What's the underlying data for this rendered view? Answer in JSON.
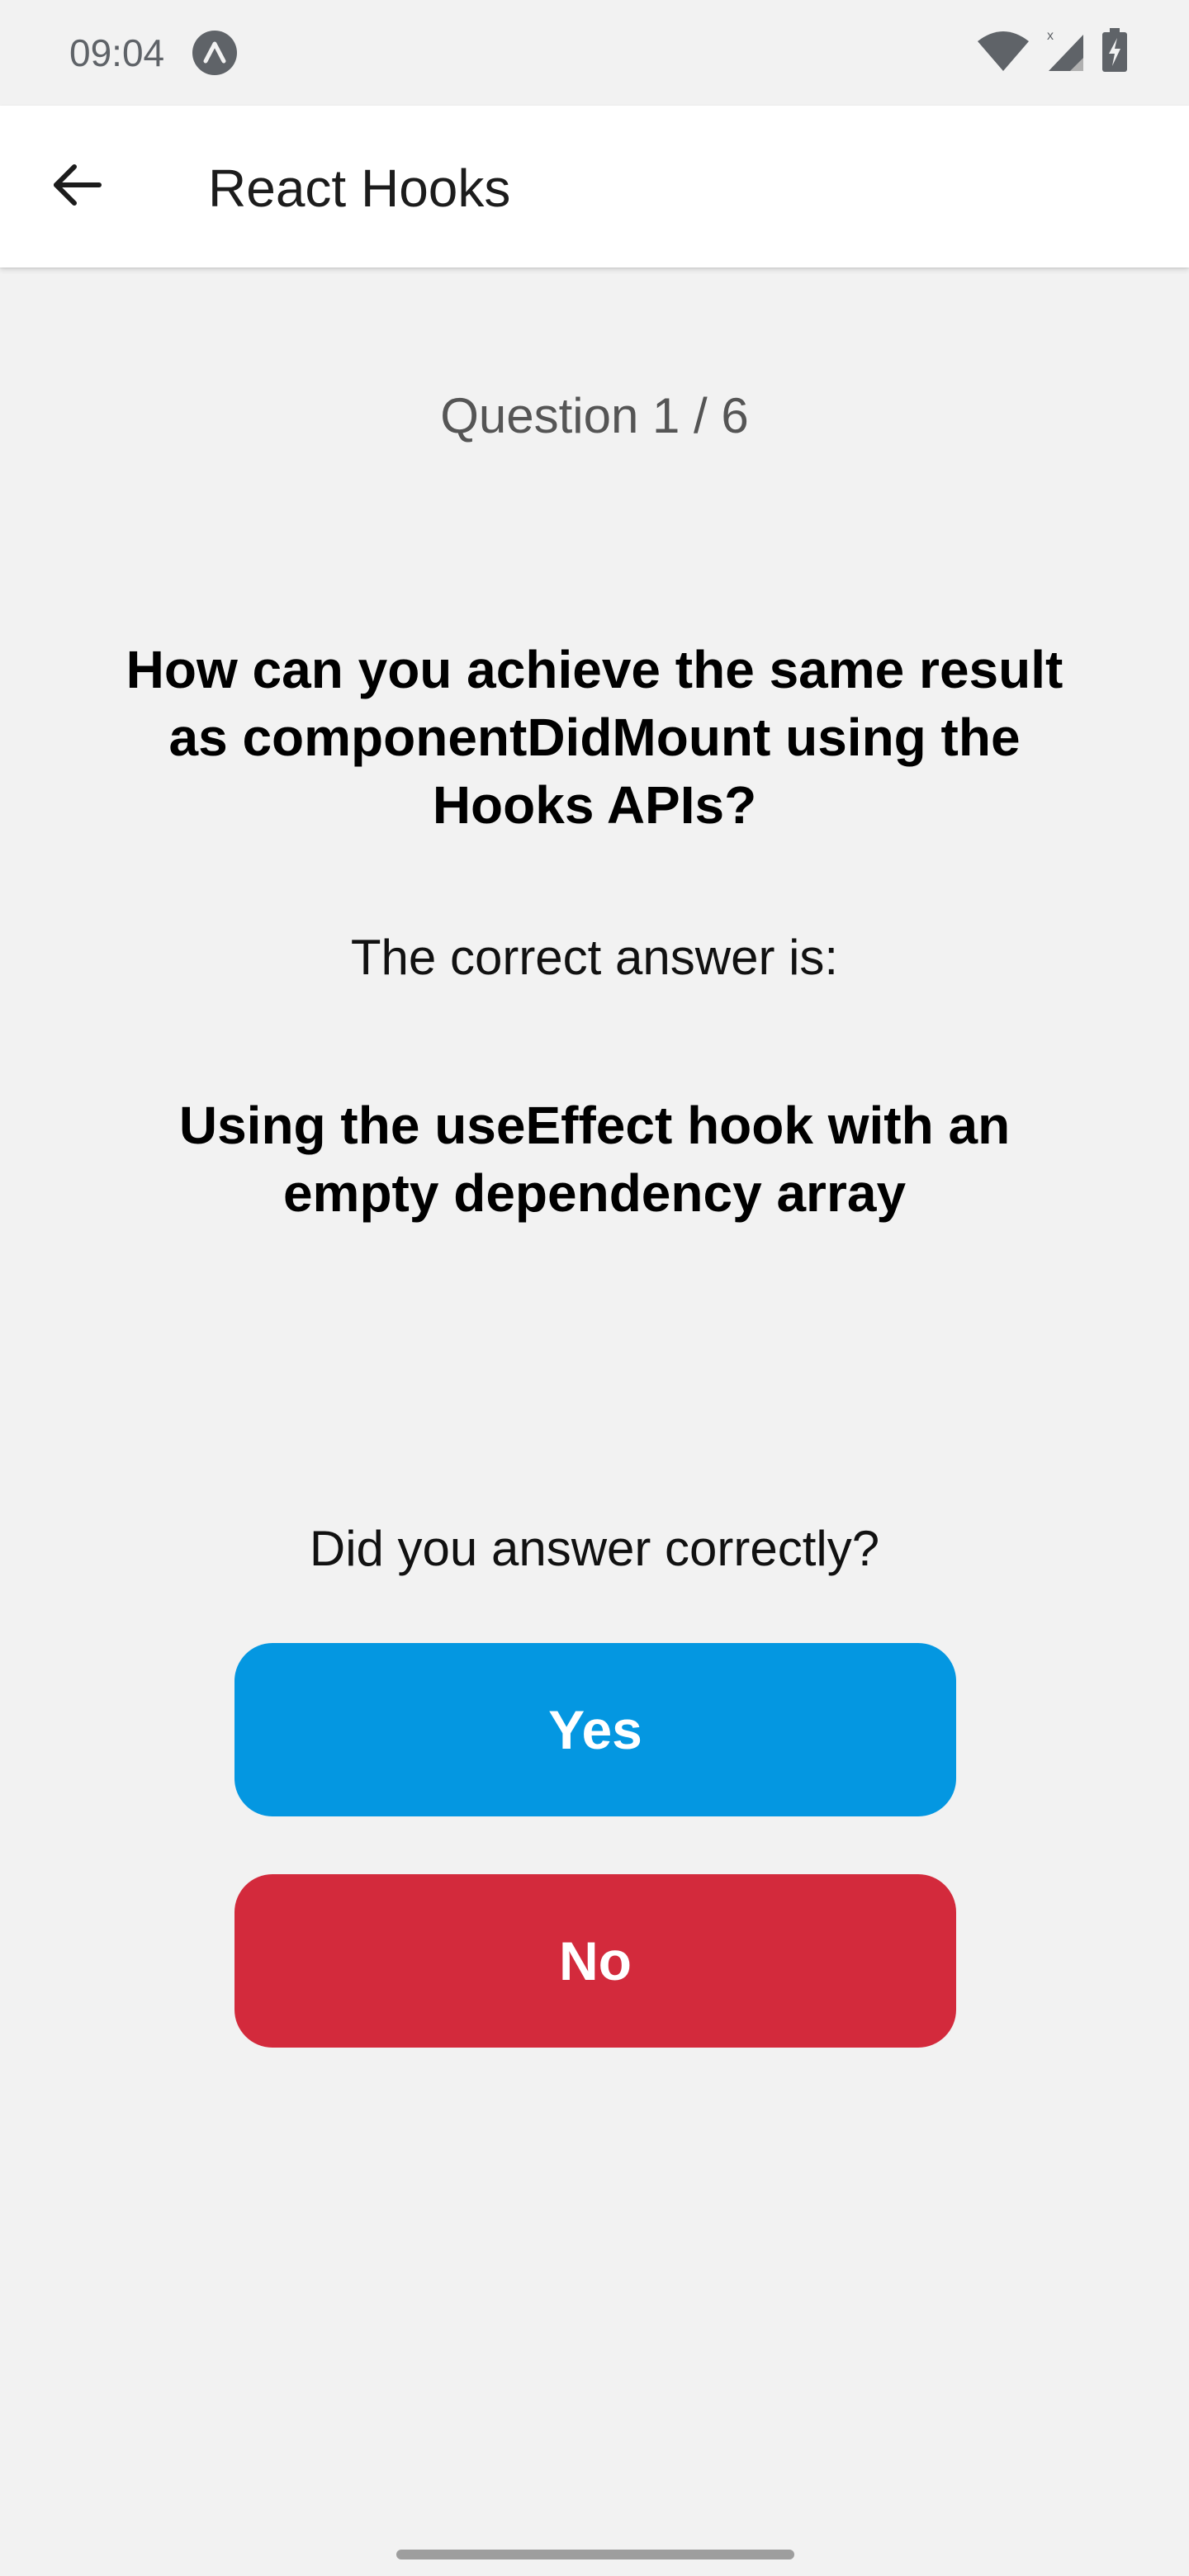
{
  "status_bar": {
    "time": "09:04",
    "icons": [
      "app-notification-icon",
      "wifi-icon",
      "cellular-signal-icon",
      "battery-charging-icon"
    ]
  },
  "app_bar": {
    "back_icon": "arrow-back-icon",
    "title": "React Hooks"
  },
  "quiz": {
    "counter": "Question 1 / 6",
    "question": "How can you achieve the same result as componentDidMount using the Hooks APIs?",
    "correct_label": "The correct answer is:",
    "answer": "Using the useEffect hook with an empty dependency array",
    "prompt": "Did you answer correctly?",
    "yes_label": "Yes",
    "no_label": "No"
  },
  "colors": {
    "background": "#f2f2f2",
    "app_bar": "#ffffff",
    "yes_button": "#0497e1",
    "no_button": "#d32a3c"
  }
}
